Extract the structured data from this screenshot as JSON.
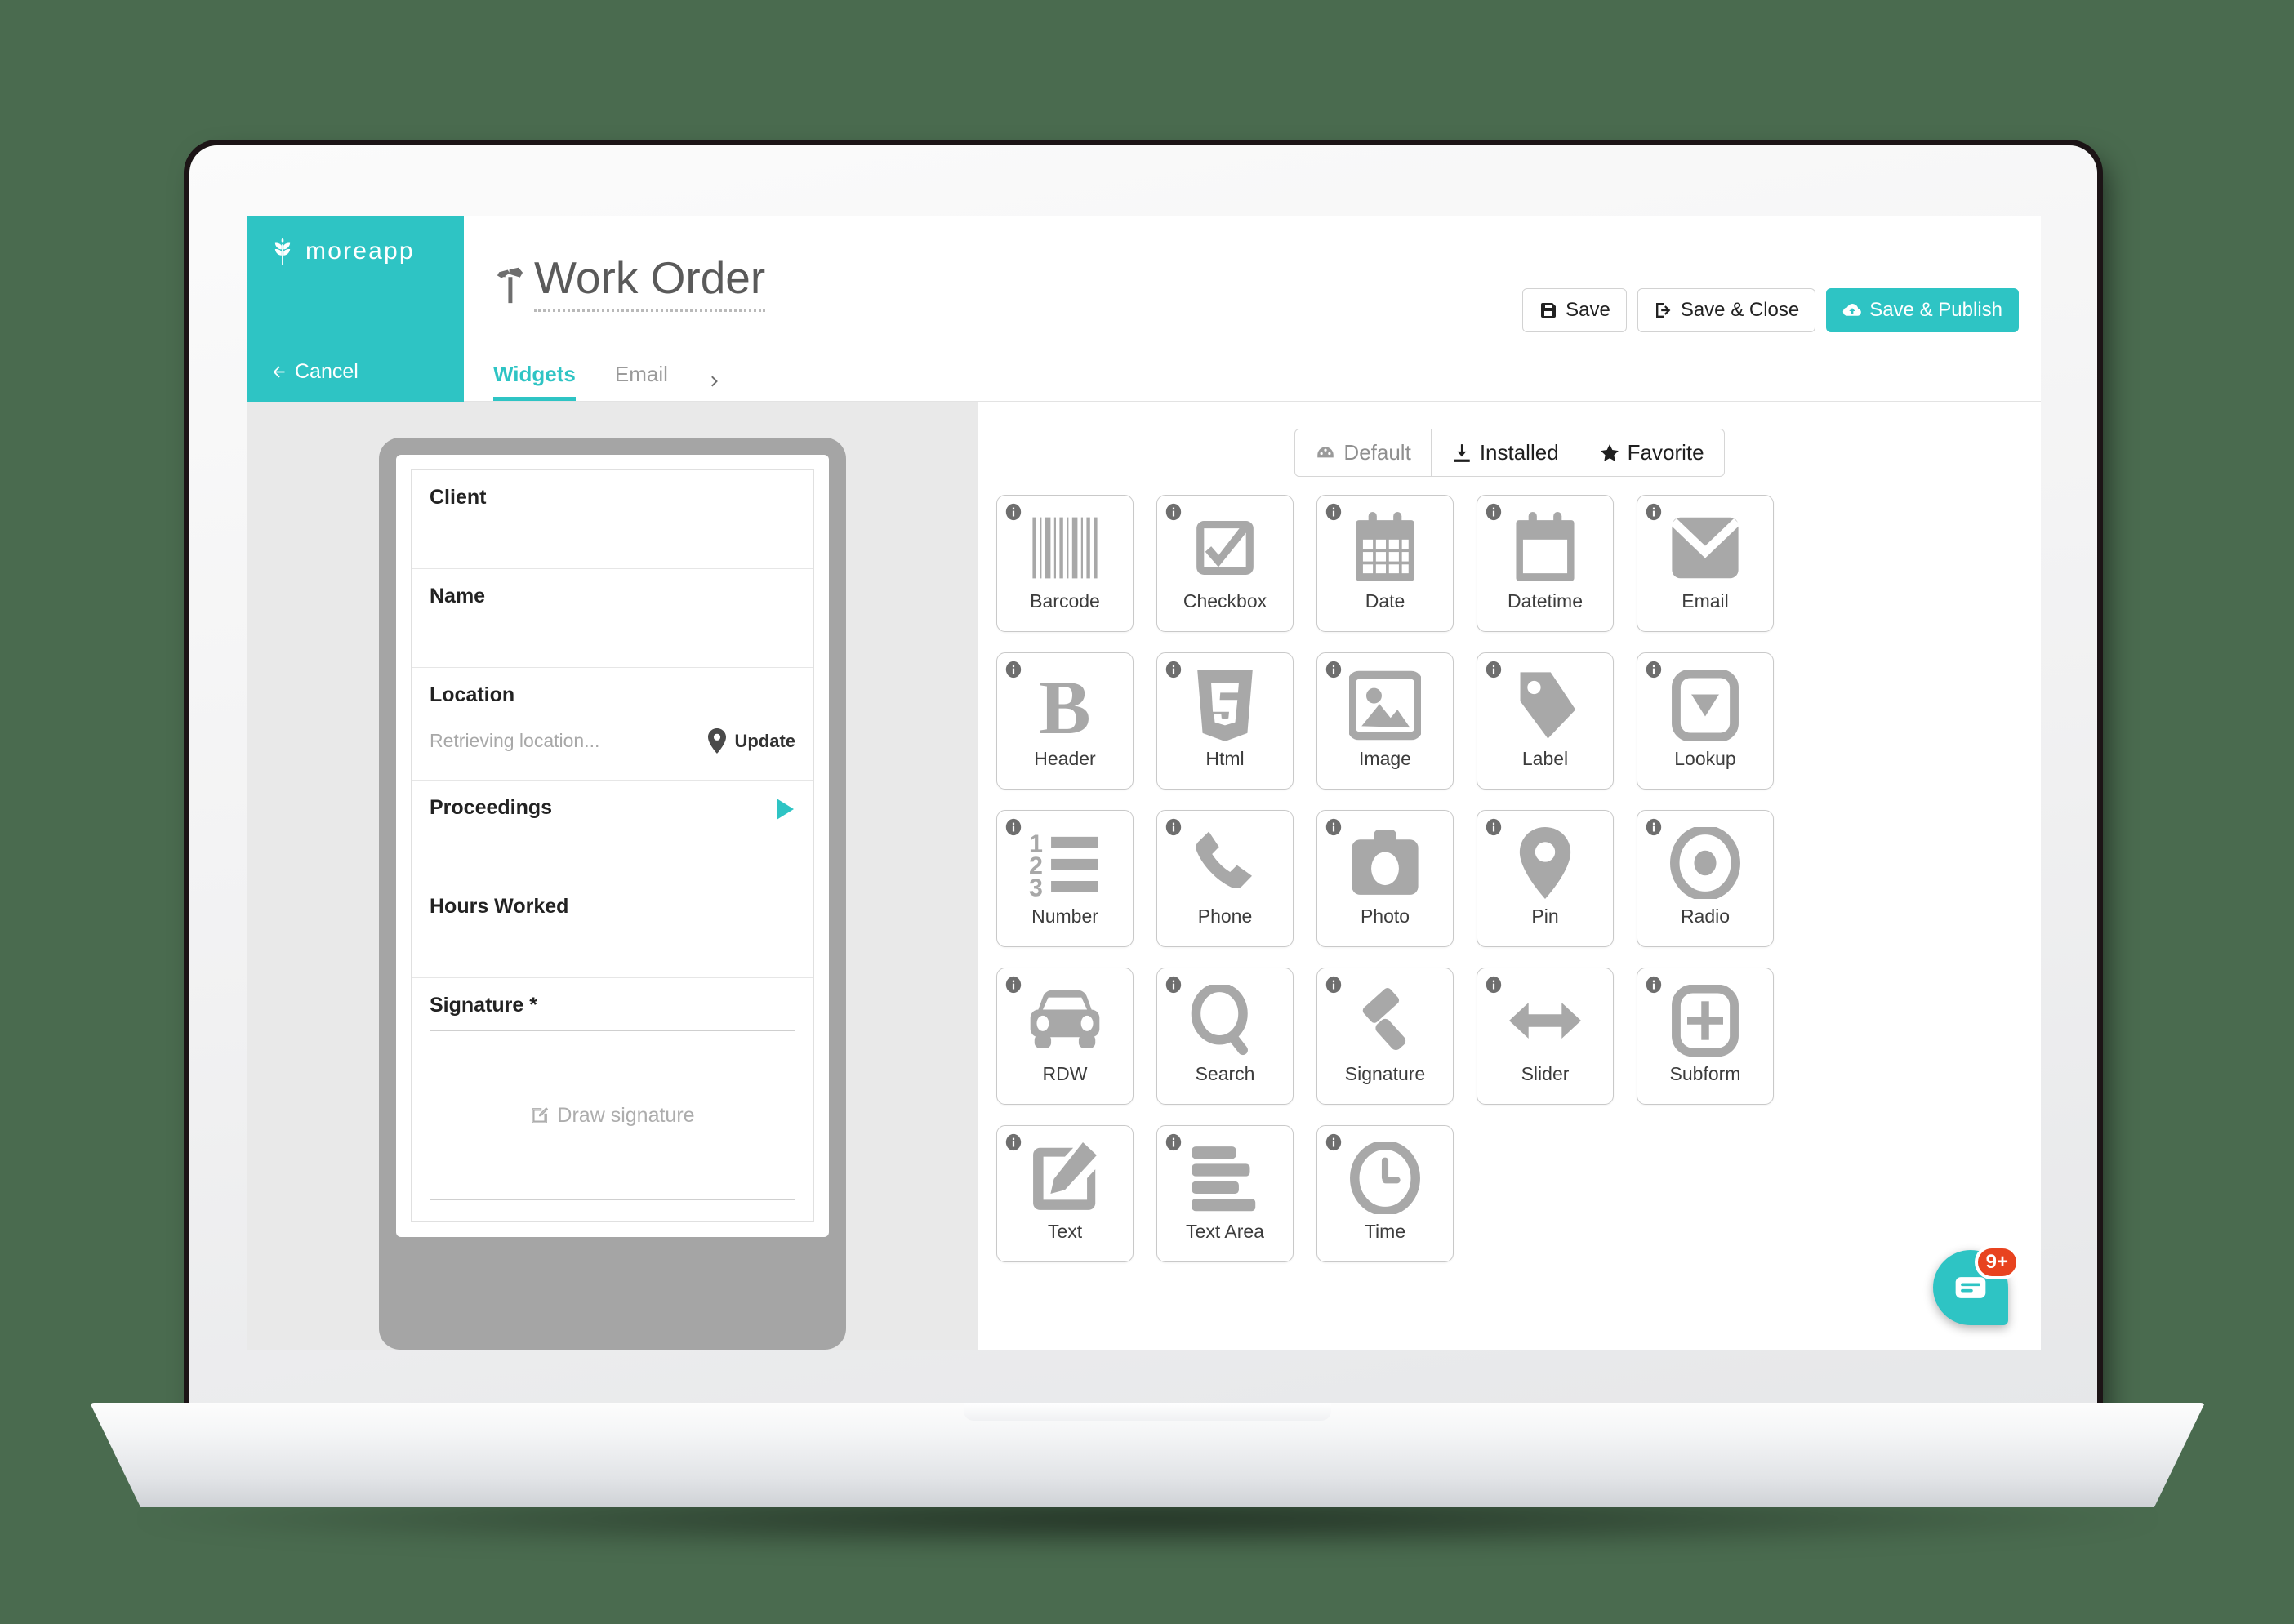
{
  "brand": {
    "name": "moreapp",
    "logo_icon": "wheat-icon",
    "accent_color": "#2ec4c4"
  },
  "nav": {
    "cancel_label": "Cancel",
    "back_icon": "arrow-left-icon"
  },
  "header": {
    "title": "Work Order",
    "title_icon": "hammer-icon",
    "tabs": [
      {
        "label": "Widgets",
        "active": true
      },
      {
        "label": "Email",
        "active": false
      }
    ],
    "more_tabs_icon": "chevron-right-icon"
  },
  "toolbar": {
    "save_label": "Save",
    "save_icon": "floppy-disk-icon",
    "save_close_label": "Save & Close",
    "save_close_icon": "sign-out-icon",
    "save_publish_label": "Save & Publish",
    "save_publish_icon": "cloud-upload-icon"
  },
  "preview": {
    "fields": [
      {
        "label": "Client",
        "type": "text"
      },
      {
        "label": "Name",
        "type": "text"
      },
      {
        "label": "Location",
        "type": "pin",
        "placeholder": "Retrieving location...",
        "action_label": "Update",
        "action_icon": "map-pin-icon"
      },
      {
        "label": "Proceedings",
        "type": "subform",
        "chevron_icon": "play-triangle-icon"
      },
      {
        "label": "Hours Worked",
        "type": "number"
      },
      {
        "label": "Signature *",
        "type": "signature",
        "canvas_placeholder": "Draw signature",
        "canvas_icon": "pencil-square-icon"
      }
    ]
  },
  "widget_panel": {
    "filters": [
      {
        "label": "Default",
        "icon": "dashboard-icon",
        "active": false
      },
      {
        "label": "Installed",
        "icon": "download-icon",
        "active": true
      },
      {
        "label": "Favorite",
        "icon": "star-icon",
        "active": true
      }
    ],
    "widgets": [
      {
        "label": "Barcode",
        "icon": "barcode-icon"
      },
      {
        "label": "Checkbox",
        "icon": "checkbox-icon"
      },
      {
        "label": "Date",
        "icon": "calendar-icon"
      },
      {
        "label": "Datetime",
        "icon": "calendar-blank-icon"
      },
      {
        "label": "Email",
        "icon": "envelope-icon"
      },
      {
        "label": "Header",
        "icon": "bold-b-icon"
      },
      {
        "label": "Html",
        "icon": "html5-icon"
      },
      {
        "label": "Image",
        "icon": "picture-icon"
      },
      {
        "label": "Label",
        "icon": "tag-icon"
      },
      {
        "label": "Lookup",
        "icon": "dropdown-icon"
      },
      {
        "label": "Number",
        "icon": "numbered-list-icon"
      },
      {
        "label": "Phone",
        "icon": "phone-icon"
      },
      {
        "label": "Photo",
        "icon": "camera-icon"
      },
      {
        "label": "Pin",
        "icon": "map-pin-icon"
      },
      {
        "label": "Radio",
        "icon": "radio-circle-icon"
      },
      {
        "label": "RDW",
        "icon": "car-icon"
      },
      {
        "label": "Search",
        "icon": "magnifier-icon"
      },
      {
        "label": "Signature",
        "icon": "gavel-icon"
      },
      {
        "label": "Slider",
        "icon": "arrows-horizontal-icon"
      },
      {
        "label": "Subform",
        "icon": "plus-square-icon"
      },
      {
        "label": "Text",
        "icon": "pencil-square-icon"
      },
      {
        "label": "Text Area",
        "icon": "text-lines-icon"
      },
      {
        "label": "Time",
        "icon": "clock-icon"
      }
    ]
  },
  "chat": {
    "badge": "9+",
    "icon": "chat-bubble-icon",
    "color": "#2ec4c4",
    "badge_color": "#e8431f"
  }
}
